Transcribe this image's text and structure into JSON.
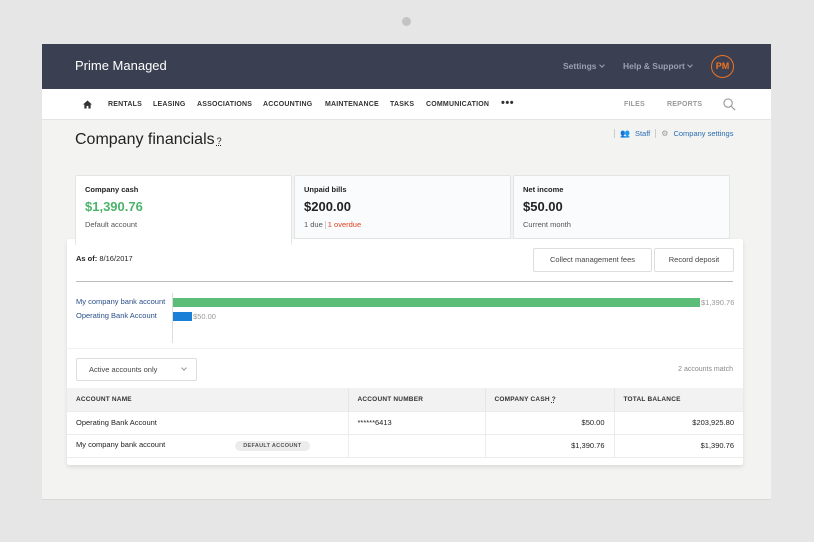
{
  "app": {
    "brand": "Prime Managed",
    "top_menu": [
      {
        "label": "Settings"
      },
      {
        "label": "Help & Support"
      }
    ],
    "avatar_initials": "PM",
    "accent_color": "#f07422"
  },
  "nav": {
    "items": [
      {
        "label": "RENTALS"
      },
      {
        "label": "LEASING"
      },
      {
        "label": "ASSOCIATIONS"
      },
      {
        "label": "ACCOUNTING"
      },
      {
        "label": "MAINTENANCE"
      },
      {
        "label": "TASKS"
      },
      {
        "label": "COMMUNICATION"
      }
    ],
    "more_label": "•••",
    "right_items": [
      {
        "label": "FILES"
      },
      {
        "label": "REPORTS"
      }
    ]
  },
  "page": {
    "title": "Company financials",
    "help_mark": "?",
    "links": {
      "staff": "Staff",
      "company_settings": "Company settings"
    }
  },
  "cards": [
    {
      "label": "Company cash",
      "value": "$1,390.76",
      "sub": "Default account"
    },
    {
      "label": "Unpaid bills",
      "value": "$200.00",
      "sub_due": "1 due",
      "sub_overdue": "1 overdue"
    },
    {
      "label": "Net income",
      "value": "$50.00",
      "sub": "Current month"
    }
  ],
  "panel": {
    "as_of_label": "As of:",
    "as_of_date": "8/16/2017",
    "buttons": {
      "collect_fees": "Collect management fees",
      "record_deposit": "Record deposit"
    }
  },
  "chart_data": {
    "type": "bar",
    "orientation": "horizontal",
    "categories": [
      "My company bank account",
      "Operating Bank Account"
    ],
    "values": [
      1390.76,
      50.0
    ],
    "value_labels": [
      "$1,390.76",
      "$50.00"
    ],
    "colors": [
      "#5bbd78",
      "#1a7fd6"
    ],
    "xlim": [
      0,
      1390.76
    ]
  },
  "filter": {
    "selected": "Active accounts only",
    "match_text": "2 accounts match"
  },
  "table": {
    "headers": [
      "ACCOUNT NAME",
      "ACCOUNT NUMBER",
      "COMPANY CASH",
      "TOTAL BALANCE"
    ],
    "company_cash_help": "?",
    "rows": [
      {
        "name": "Operating Bank Account",
        "badge": "",
        "number": "******6413",
        "company_cash": "$50.00",
        "total_balance": "$203,925.80"
      },
      {
        "name": "My company bank account",
        "badge": "DEFAULT ACCOUNT",
        "number": "",
        "company_cash": "$1,390.76",
        "total_balance": "$1,390.76"
      }
    ]
  }
}
